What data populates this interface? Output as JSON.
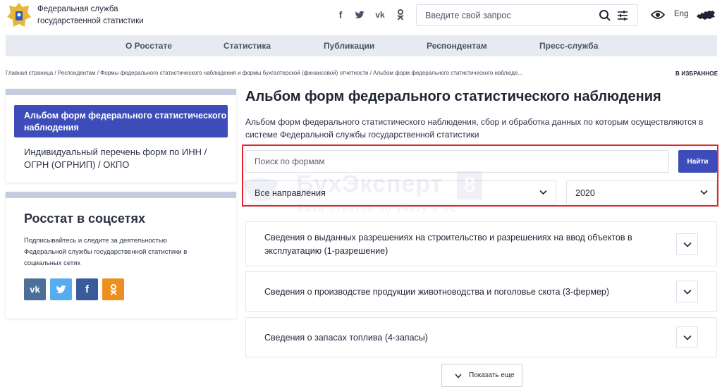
{
  "header": {
    "org_name": "Федеральная служба государственной статистики",
    "social": [
      "f",
      "t",
      "vk",
      "ok"
    ],
    "search_placeholder": "Введите свой запрос",
    "lang": "Eng"
  },
  "nav": {
    "items": [
      "О Росстате",
      "Статистика",
      "Публикации",
      "Респондентам",
      "Пресс-служба"
    ]
  },
  "breadcrumb": "Главная страница / Респондентам / Формы федерального статистического наблюдения и формы бухгалтерской (финансовой) отчетности / Альбом форм федерального статистического наблюде...",
  "favorites_label": "В ИЗБРАННОЕ",
  "sidebar": {
    "items": [
      {
        "label": "Альбом форм федерального статистического наблюдения",
        "active": true
      },
      {
        "label": "Индивидуальный перечень форм по ИНН / ОГРН (ОГРНИП) / ОКПО",
        "active": false
      }
    ],
    "social_block": {
      "title": "Росстат в соцсетях",
      "text": "Подписывайтесь и следите за деятельностью Федеральной службы государственной статистики в социальных сетях",
      "buttons": [
        {
          "icon": "vk-icon",
          "label": "vk",
          "color": "#4c6e99"
        },
        {
          "icon": "twitter-icon",
          "label": "t",
          "color": "#55acee"
        },
        {
          "icon": "facebook-icon",
          "label": "f",
          "color": "#3b5a9a"
        },
        {
          "icon": "odnoklassniki-icon",
          "label": "ok",
          "color": "#ed8f1f"
        }
      ]
    }
  },
  "main": {
    "title": "Альбом форм федерального статистического наблюдения",
    "description": "Альбом форм федерального статистического наблюдения, сбор и обработка данных по которым осуществляются в системе Федеральной службы государственной статистики",
    "forms_search_placeholder": "Поиск по формам",
    "find_button": "Найти",
    "direction_select": "Все направления",
    "year_select": "2020",
    "forms": [
      "Сведения о выданных разрешениях на строительство и разрешениях на ввод объектов в эксплуатацию (1-разрешение)",
      "Сведения о производстве продукции животноводства и поголовье скота (3-фермер)",
      "Сведения о запасах топлива (4-запасы)"
    ],
    "show_more": "Показать еще"
  },
  "watermark": {
    "title": "БухЭксперт",
    "badge": "8",
    "subtitle": "База ответов по учету в 1С"
  },
  "colors": {
    "accent": "#3d4cb8",
    "highlight_frame": "#e5232b",
    "nav_bg": "#e7eaf1"
  }
}
